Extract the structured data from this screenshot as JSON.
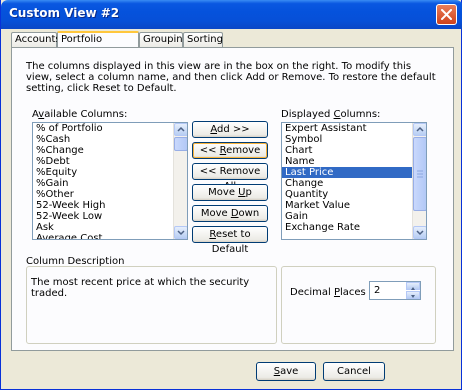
{
  "window": {
    "title": "Custom View #2"
  },
  "tabs": [
    {
      "label": "Accounts"
    },
    {
      "label": "Portfolio Columns"
    },
    {
      "label": "Grouping"
    },
    {
      "label": "Sorting"
    }
  ],
  "description": "The columns displayed in this view are in the box on the right. To modify this view, select a column name, and then click Add or Remove. To restore the default setting, click Reset to Default.",
  "available": {
    "label_prefix": "A",
    "label_accel": "v",
    "label_suffix": "ailable Columns:",
    "items": [
      "% of Portfolio",
      "%Cash",
      "%Change",
      "%Debt",
      "%Equity",
      "%Gain",
      "%Other",
      "52-Week High",
      "52-Week Low",
      "Ask",
      "Average Cost"
    ]
  },
  "displayed": {
    "label_prefix": "Displayed ",
    "label_accel": "C",
    "label_suffix": "olumns:",
    "items": [
      "Expert Assistant",
      "Symbol",
      "Chart",
      "Name",
      "Last Price",
      "Change",
      "Quantity",
      "Market Value",
      "Gain",
      "Exchange Rate"
    ],
    "selected_index": 4
  },
  "buttons": {
    "add": {
      "accel": "A",
      "rest": "dd >>"
    },
    "remove": {
      "pre": "<< ",
      "accel": "R",
      "rest": "emove"
    },
    "remove_all": {
      "pre": "<< Remove A",
      "accel": "l",
      "rest": "l"
    },
    "move_up": {
      "pre": "Move ",
      "accel": "U",
      "rest": "p"
    },
    "move_down": {
      "pre": "Move ",
      "accel": "D",
      "rest": "own"
    },
    "reset": {
      "accel": "R",
      "rest": "eset to Default"
    },
    "save": {
      "accel": "S",
      "rest": "ave"
    },
    "cancel": "Cancel"
  },
  "column_description": {
    "label": "Column Description",
    "text": "The most recent price at which the security traded."
  },
  "decimal": {
    "label_prefix": "Decimal ",
    "label_accel": "P",
    "label_suffix": "laces",
    "value": "2"
  },
  "colors": {
    "titlebar": "#0552dc",
    "selection": "#316ac5",
    "close": "#d0421b"
  }
}
